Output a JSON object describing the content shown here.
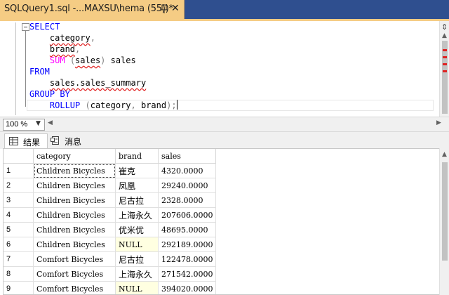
{
  "tab": {
    "title": "SQLQuery1.sql -...MAXSU\\hema (55))*",
    "close_glyph": "✕",
    "pin_icon": "pin-icon"
  },
  "editor": {
    "lines": [
      {
        "tokens": [
          {
            "t": "SELECT",
            "c": "kw"
          }
        ]
      },
      {
        "tokens": [
          {
            "t": "    ",
            "c": ""
          },
          {
            "t": "category",
            "c": "sq"
          },
          {
            "t": ",",
            "c": "gr"
          }
        ]
      },
      {
        "tokens": [
          {
            "t": "    ",
            "c": ""
          },
          {
            "t": "brand",
            "c": "sq"
          },
          {
            "t": ",",
            "c": "gr"
          }
        ]
      },
      {
        "tokens": [
          {
            "t": "    ",
            "c": ""
          },
          {
            "t": "SUM",
            "c": "fn"
          },
          {
            "t": " (",
            "c": "gr"
          },
          {
            "t": "sales",
            "c": "sq"
          },
          {
            "t": ")",
            "c": "gr"
          },
          {
            "t": " sales",
            "c": ""
          }
        ]
      },
      {
        "tokens": [
          {
            "t": "FROM",
            "c": "kw"
          }
        ]
      },
      {
        "tokens": [
          {
            "t": "    ",
            "c": ""
          },
          {
            "t": "sales.sales_summary",
            "c": "sq"
          }
        ]
      },
      {
        "tokens": [
          {
            "t": "GROUP BY",
            "c": "kw"
          }
        ]
      },
      {
        "tokens": [
          {
            "t": "    ",
            "c": ""
          },
          {
            "t": "ROLLUP",
            "c": "kw"
          },
          {
            "t": " (",
            "c": "gr"
          },
          {
            "t": "category",
            "c": ""
          },
          {
            "t": ", ",
            "c": "gr"
          },
          {
            "t": "brand",
            "c": ""
          },
          {
            "t": ");",
            "c": "gr"
          }
        ]
      }
    ]
  },
  "zoom": {
    "value": "100 %"
  },
  "results_tabs": [
    {
      "label": "结果",
      "icon": "grid-icon"
    },
    {
      "label": "消息",
      "icon": "messages-icon"
    }
  ],
  "grid": {
    "columns": [
      "category",
      "brand",
      "sales"
    ],
    "rows": [
      {
        "n": "1",
        "category": "Children Bicycles",
        "brand": "崔克",
        "sales": "4320.0000"
      },
      {
        "n": "2",
        "category": "Children Bicycles",
        "brand": "凤凰",
        "sales": "29240.0000"
      },
      {
        "n": "3",
        "category": "Children Bicycles",
        "brand": "尼古拉",
        "sales": "2328.0000"
      },
      {
        "n": "4",
        "category": "Children Bicycles",
        "brand": "上海永久",
        "sales": "207606.0000"
      },
      {
        "n": "5",
        "category": "Children Bicycles",
        "brand": "优米优",
        "sales": "48695.0000"
      },
      {
        "n": "6",
        "category": "Children Bicycles",
        "brand": "NULL",
        "sales": "292189.0000"
      },
      {
        "n": "7",
        "category": "Comfort Bicycles",
        "brand": "尼古拉",
        "sales": "122478.0000"
      },
      {
        "n": "8",
        "category": "Comfort Bicycles",
        "brand": "上海永久",
        "sales": "271542.0000"
      },
      {
        "n": "9",
        "category": "Comfort Bicycles",
        "brand": "NULL",
        "sales": "394020.0000"
      }
    ]
  },
  "colors": {
    "tab_active": "#f5cc84",
    "tab_strip": "#2f4f8f",
    "keyword": "#0000ff",
    "function": "#ff00ff",
    "operator": "#808080",
    "null_cell": "#ffffe1"
  }
}
